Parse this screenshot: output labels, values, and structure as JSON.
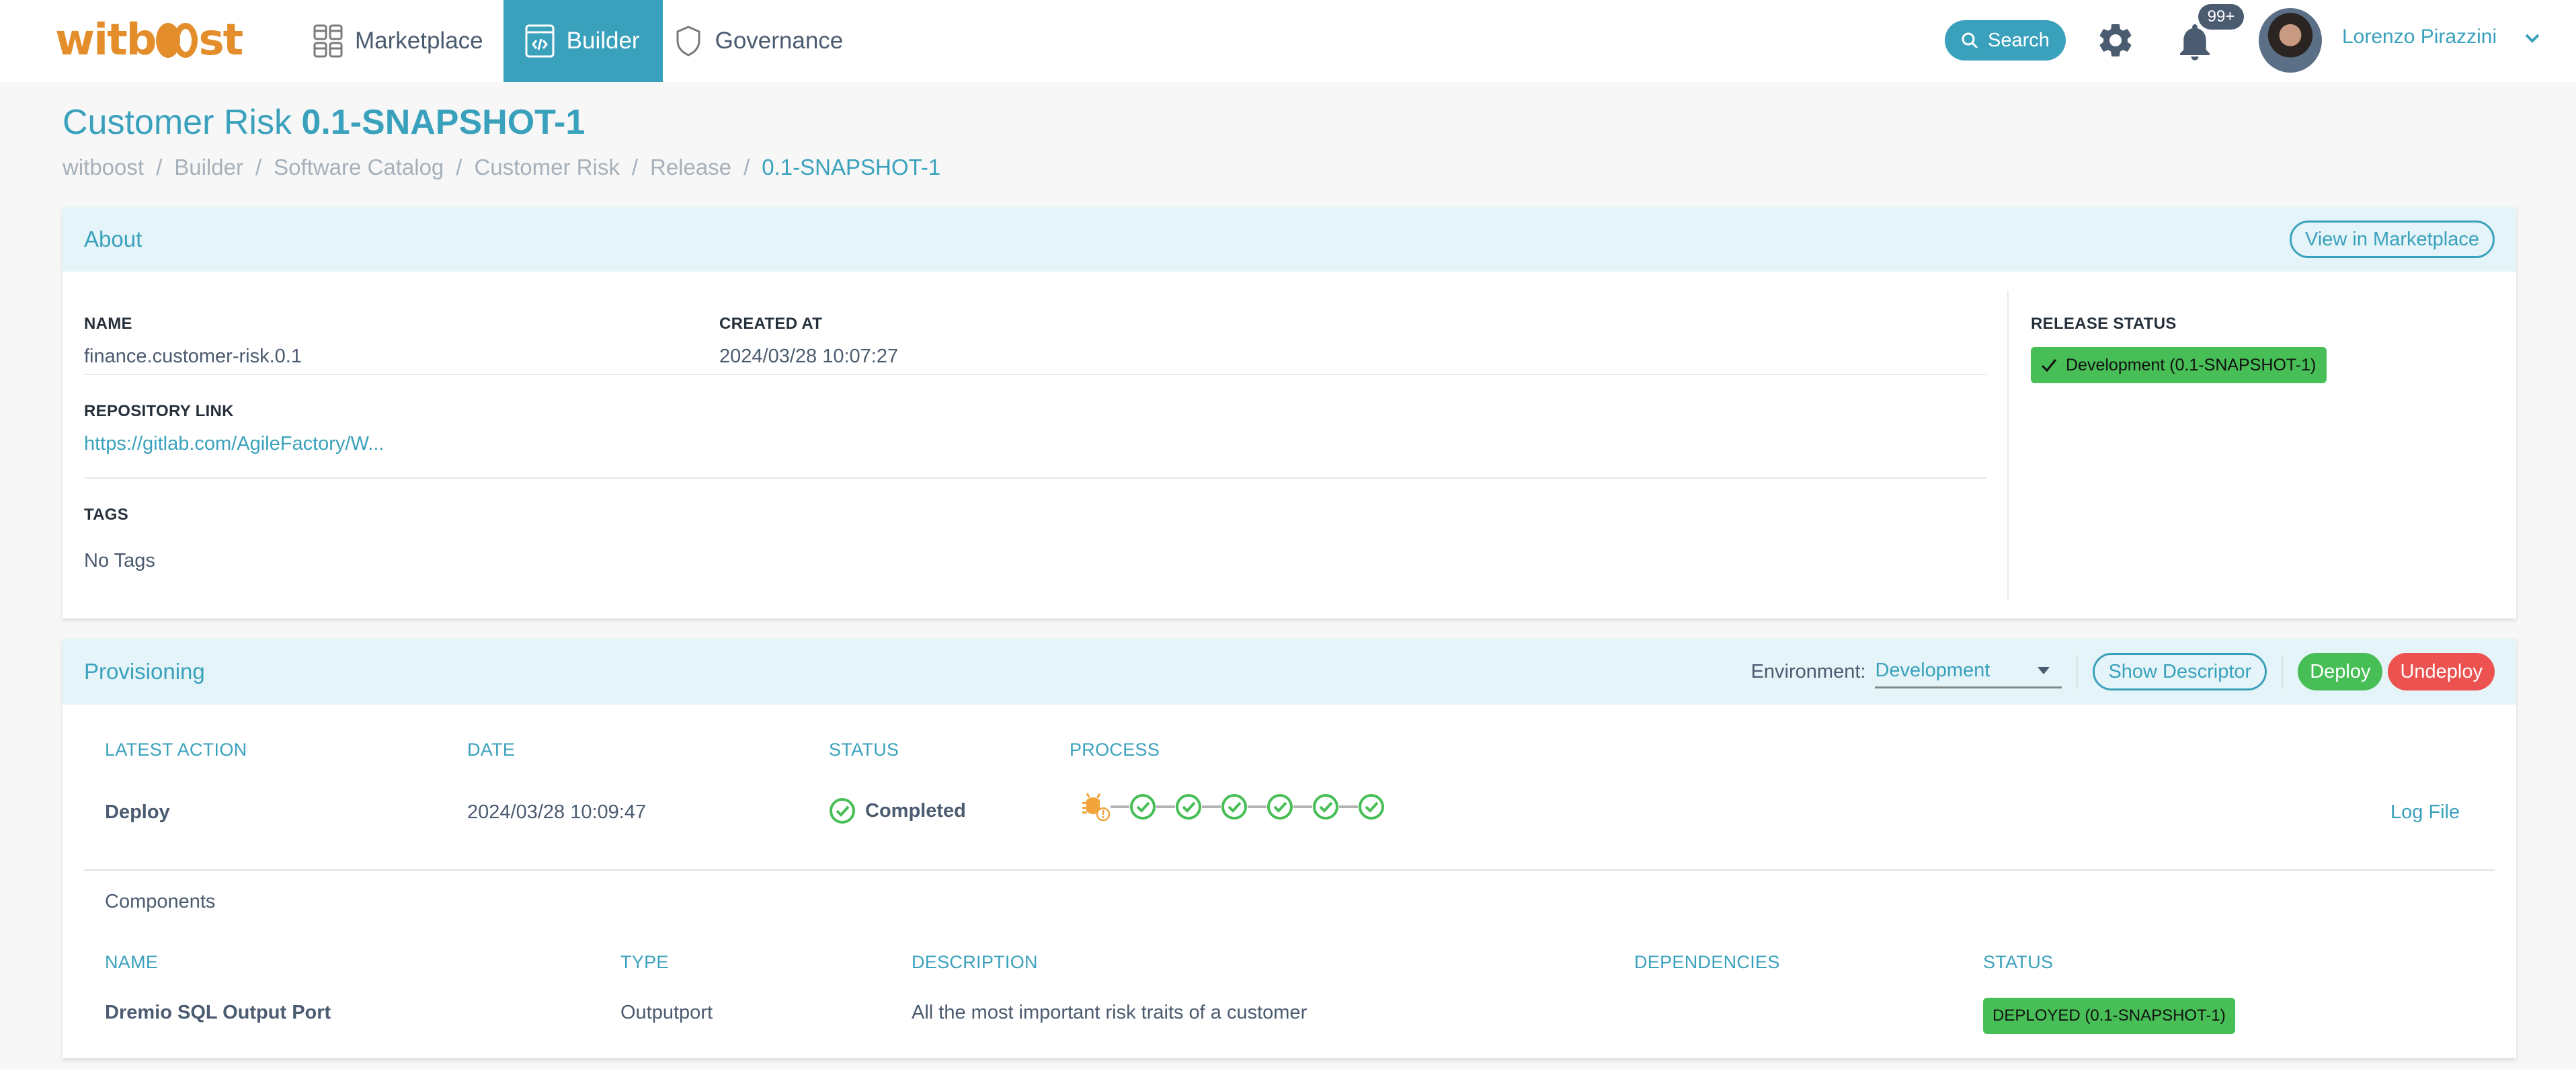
{
  "topbar": {
    "logo": "witboost",
    "nav": [
      {
        "label": "Marketplace",
        "icon": "grid-icon",
        "active": false
      },
      {
        "label": "Builder",
        "icon": "code-window-icon",
        "active": true
      },
      {
        "label": "Governance",
        "icon": "shield-icon",
        "active": false
      }
    ],
    "search_label": "Search",
    "notifications_badge": "99+",
    "user_name": "Lorenzo Pirazzini"
  },
  "page": {
    "title_main": "Customer Risk",
    "title_version": "0.1-SNAPSHOT-1",
    "breadcrumb": [
      "witboost",
      "Builder",
      "Software Catalog",
      "Customer Risk",
      "Release",
      "0.1-SNAPSHOT-1"
    ]
  },
  "about": {
    "title": "About",
    "view_marketplace_label": "View in Marketplace",
    "name_label": "NAME",
    "name_value": "finance.customer-risk.0.1",
    "created_label": "CREATED AT",
    "created_value": "2024/03/28 10:07:27",
    "repo_label": "REPOSITORY LINK",
    "repo_value": "https://gitlab.com/AgileFactory/W...",
    "tags_label": "TAGS",
    "tags_value": "No Tags",
    "release_status_label": "RELEASE STATUS",
    "release_status_value": "Development (0.1-SNAPSHOT-1)",
    "release_status_color": "#47be56"
  },
  "provisioning": {
    "title": "Provisioning",
    "environment_label": "Environment:",
    "environment_value": "Development",
    "show_descriptor_label": "Show Descriptor",
    "deploy_label": "Deploy",
    "undeploy_label": "Undeploy",
    "columns": [
      "LATEST ACTION",
      "DATE",
      "STATUS",
      "PROCESS"
    ],
    "latest": {
      "action": "Deploy",
      "date": "2024/03/28 10:09:47",
      "status": "Completed",
      "process_steps": [
        "warning",
        "ok",
        "ok",
        "ok",
        "ok",
        "ok",
        "ok"
      ]
    },
    "log_file_label": "Log File",
    "components_title": "Components",
    "component_columns": [
      "NAME",
      "TYPE",
      "DESCRIPTION",
      "DEPENDENCIES",
      "STATUS"
    ],
    "components": [
      {
        "name": "Dremio SQL Output Port",
        "type": "Outputport",
        "description": "All the most important risk traits of a customer",
        "dependencies": "",
        "status": "DEPLOYED (0.1-SNAPSHOT-1)"
      }
    ]
  },
  "colors": {
    "accent": "#3aa1bd",
    "logo": "#e38e2a",
    "success": "#47be56",
    "danger": "#ec5350",
    "header_bg": "#e5f4f8"
  }
}
